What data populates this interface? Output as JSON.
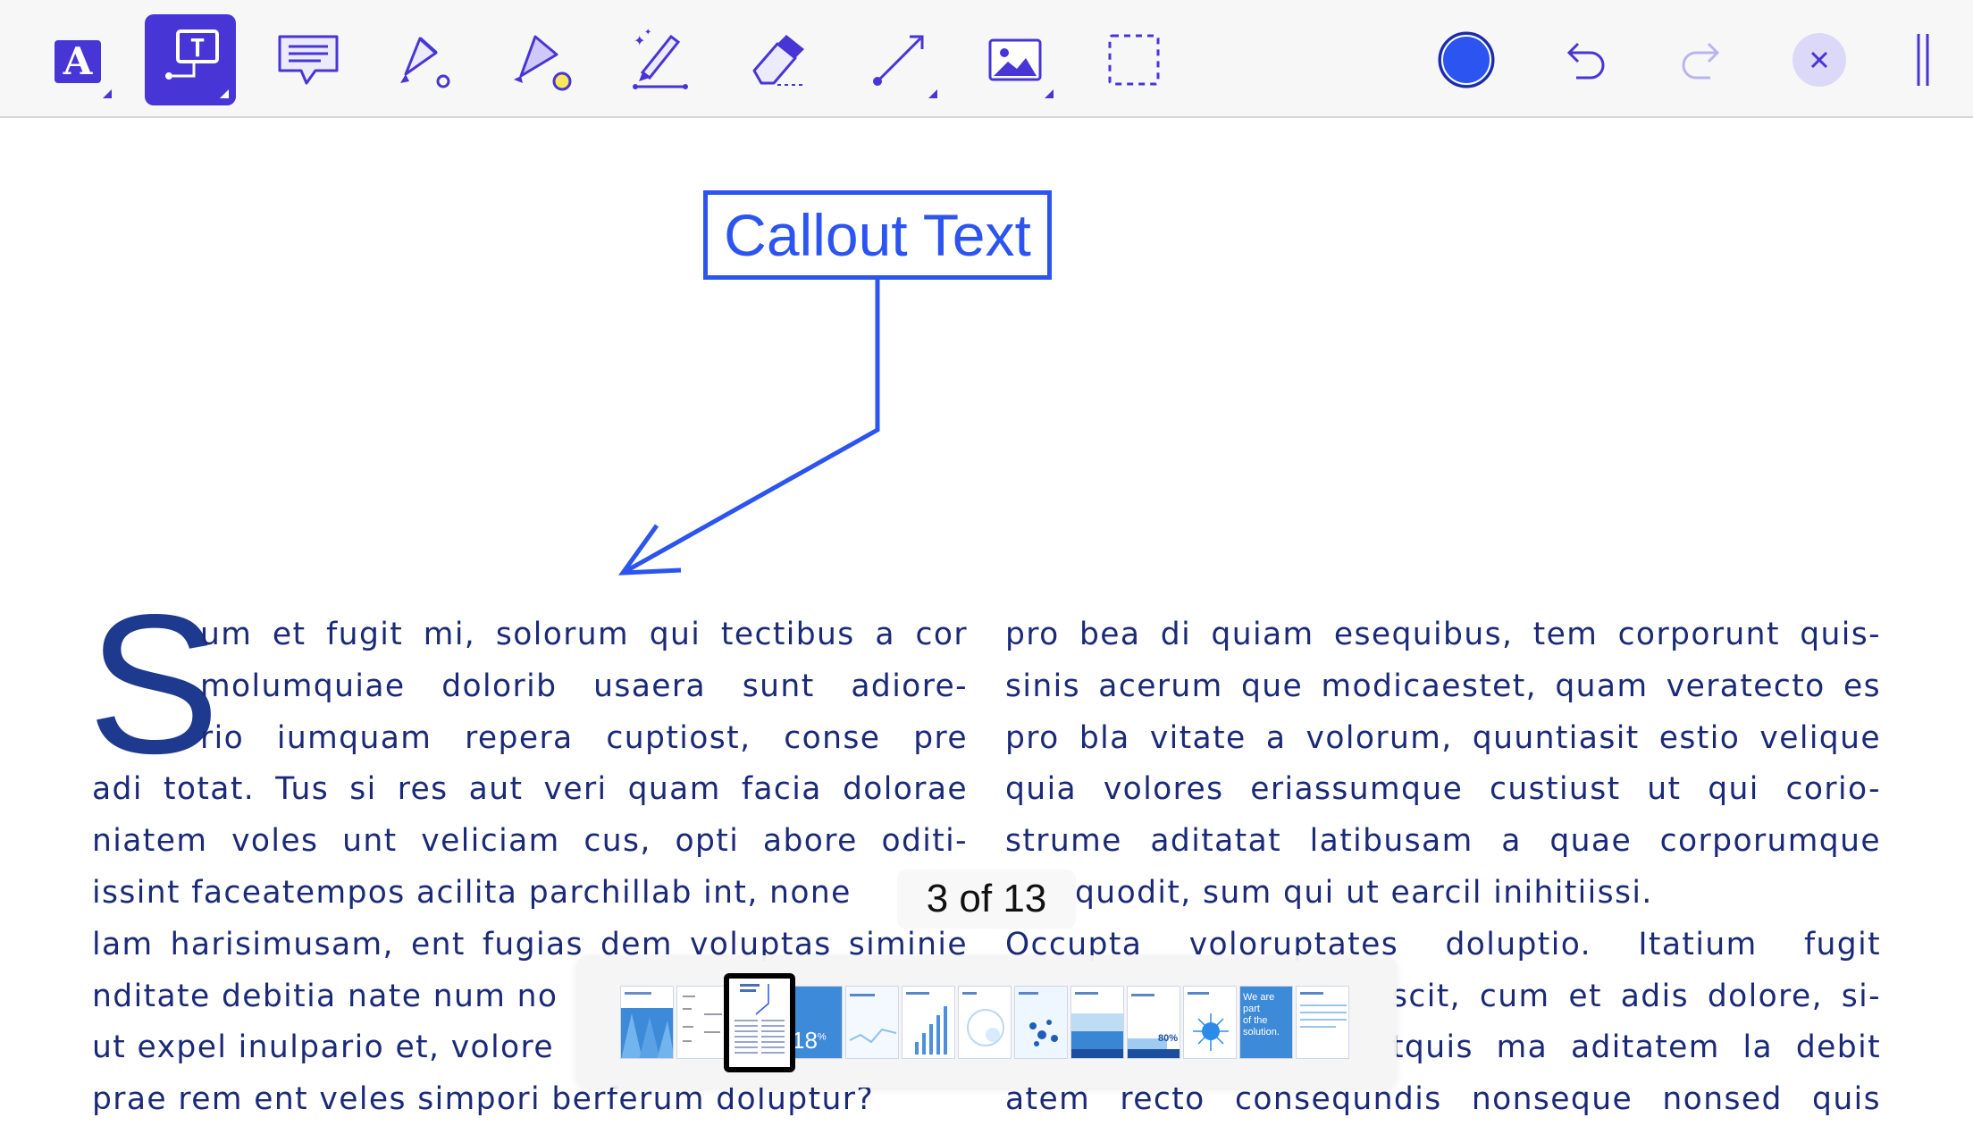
{
  "toolbar": {
    "tools": [
      {
        "name": "text-style-tool",
        "icon": "letter-a-icon",
        "label": "A"
      },
      {
        "name": "callout-text-tool",
        "icon": "callout-t-icon",
        "label": "T",
        "active": true
      },
      {
        "name": "note-tool",
        "icon": "speech-bubble-icon"
      },
      {
        "name": "highlighter-tool",
        "icon": "highlighter-icon"
      },
      {
        "name": "marker-tool",
        "icon": "marker-icon"
      },
      {
        "name": "magic-pen-tool",
        "icon": "magic-pen-icon"
      },
      {
        "name": "eraser-tool",
        "icon": "eraser-icon"
      },
      {
        "name": "line-tool",
        "icon": "line-arrow-icon"
      },
      {
        "name": "image-tool",
        "icon": "image-icon"
      },
      {
        "name": "selection-tool",
        "icon": "dashed-selection-icon"
      }
    ],
    "color_swatch": "#2b54f0",
    "accent": "#4735d6"
  },
  "callout": {
    "text": "Callout Text",
    "color": "#2b54f0"
  },
  "document": {
    "drop_cap": "S",
    "left_lines": [
      "um et fugit mi, solorum qui tectibus a cor",
      "molumquiae dolorib usaera sunt adiore-",
      "rio iumquam repera cuptiost, conse pre",
      "adi totat. Tus si res aut veri quam facia dolorae",
      "niatem voles unt veliciam cus, opti abore oditi-",
      "issint faceatempos acilita parchillab int, none",
      "lam harisimusam, ent fugias dem voluptas siminie",
      "nditate debitia nate num no",
      "ut expel inulpario et, volore",
      "prae rem ent veles simpori berferum doluptur?"
    ],
    "right_lines": [
      "pro bea di quiam esequibus, tem corporunt quis-",
      "sinis acerum que modicaestet, quam veratecto es",
      "pro bla vitate a volorum, quuntiasit estio velique",
      "quia volores eriassumque custiust ut qui corio-",
      "strume aditatat latibusam a quae corporumque",
      "quodit, sum qui ut earcil inihitiissi.",
      "Occupta voloruptates doluptio. Itatium fugit",
      "scit, cum et adis dolore, si-",
      "tquis ma aditatem la debit",
      "atem recto consequndis nonseque nonsed quis"
    ]
  },
  "navigator": {
    "page_label": "3 of 13",
    "current_page": 3,
    "total_pages": 13,
    "thumb_texts": {
      "p4": "18",
      "p4_unit": "%",
      "p10": "80%",
      "p12": [
        "We are",
        "part",
        "of the",
        "solution."
      ]
    }
  }
}
